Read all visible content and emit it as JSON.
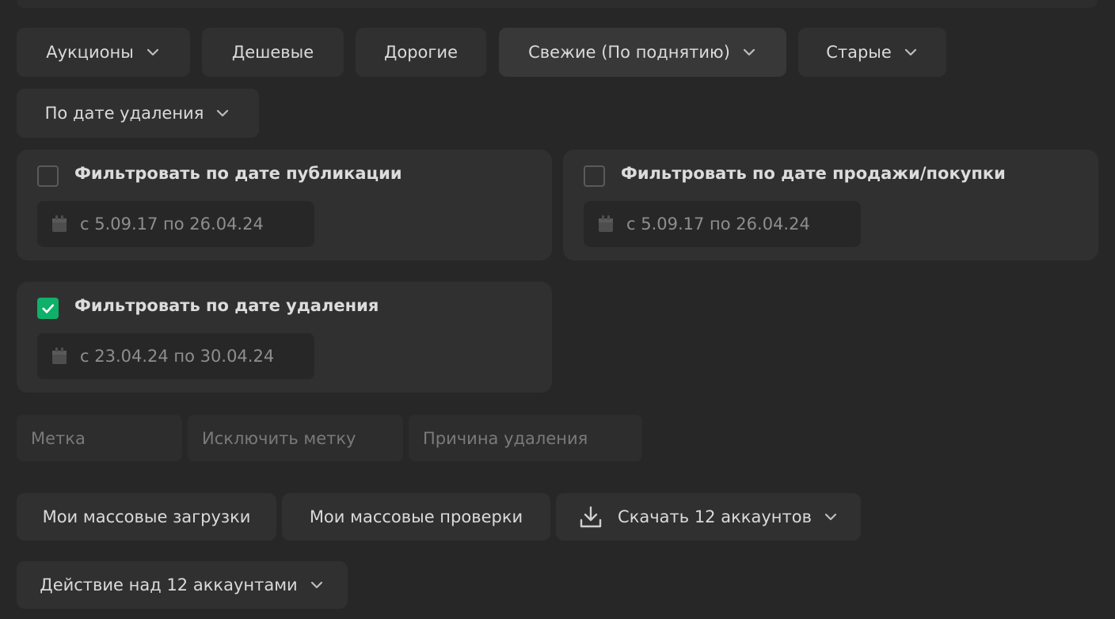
{
  "sort_buttons": {
    "auctions": "Аукционы",
    "cheap": "Дешевые",
    "expensive": "Дорогие",
    "fresh": "Свежие (По поднятию)",
    "old": "Старые",
    "by_deletion": "По дате удаления"
  },
  "filters": {
    "publication": {
      "label": "Фильтровать по дате публикации",
      "range": "с 5.09.17 по 26.04.24",
      "checked": false
    },
    "sale": {
      "label": "Фильтровать по дате продажи/покупки",
      "range": "с 5.09.17 по 26.04.24",
      "checked": false
    },
    "deletion": {
      "label": "Фильтровать по дате удаления",
      "range": "с 23.04.24 по 30.04.24",
      "checked": true
    }
  },
  "inputs": {
    "tag_placeholder": "Метка",
    "exclude_tag_placeholder": "Исключить метку",
    "reason_placeholder": "Причина удаления"
  },
  "actions": {
    "mass_uploads": "Мои массовые загрузки",
    "mass_checks": "Мои массовые проверки",
    "download": "Скачать 12 аккаунтов",
    "bulk_action": "Действие над 12 аккаунтами"
  },
  "colors": {
    "background": "#272727",
    "panel": "#303030",
    "checkbox_accent": "#0fb06a"
  }
}
